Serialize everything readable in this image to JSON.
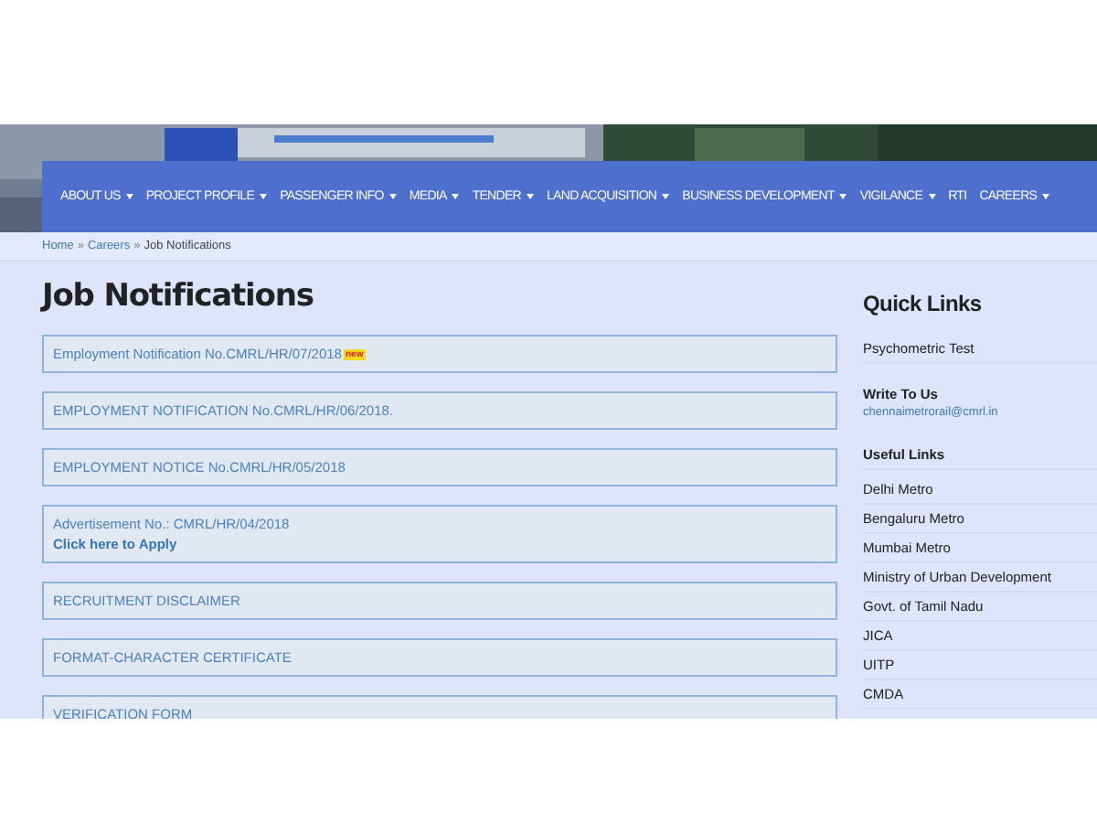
{
  "nav": [
    {
      "label": "ABOUT US",
      "dropdown": true
    },
    {
      "label": "PROJECT PROFILE",
      "dropdown": true
    },
    {
      "label": "PASSENGER INFO",
      "dropdown": true
    },
    {
      "label": "MEDIA",
      "dropdown": true
    },
    {
      "label": "TENDER",
      "dropdown": true
    },
    {
      "label": "LAND ACQUISITION",
      "dropdown": true
    },
    {
      "label": "BUSINESS DEVELOPMENT",
      "dropdown": true
    },
    {
      "label": "VIGILANCE",
      "dropdown": true
    },
    {
      "label": "RTI",
      "dropdown": false
    },
    {
      "label": "CAREERS",
      "dropdown": true
    }
  ],
  "breadcrumb_separator": "»",
  "breadcrumb": [
    {
      "label": "Home",
      "link": true
    },
    {
      "label": "Careers",
      "link": true
    },
    {
      "label": "Job Notifications",
      "link": false
    }
  ],
  "page_title": "Job Notifications",
  "notices": [
    {
      "title": "Employment Notification No.CMRL/HR/07/2018",
      "badge": "new"
    },
    {
      "title": "EMPLOYMENT NOTIFICATION No.CMRL/HR/06/2018."
    },
    {
      "title": "EMPLOYMENT NOTICE No.CMRL/HR/05/2018"
    },
    {
      "title": "Advertisement No.: CMRL/HR/04/2018",
      "link": "Click here to Apply"
    },
    {
      "title": "RECRUITMENT DISCLAIMER"
    },
    {
      "title": "FORMAT-CHARACTER CERTIFICATE"
    },
    {
      "title": "VERIFICATION FORM"
    }
  ],
  "sidebar": {
    "quick_links_title": "Quick Links",
    "quick_links": [
      "Psychometric Test"
    ],
    "write_to_us": {
      "title": "Write To Us",
      "email": "chennaimetrorail@cmrl.in"
    },
    "useful_links_title": "Useful Links",
    "useful_links": [
      "Delhi Metro",
      "Bengaluru Metro",
      "Mumbai Metro",
      "Ministry of Urban Development",
      "Govt. of Tamil Nadu",
      "JICA",
      "UITP",
      "CMDA"
    ]
  }
}
